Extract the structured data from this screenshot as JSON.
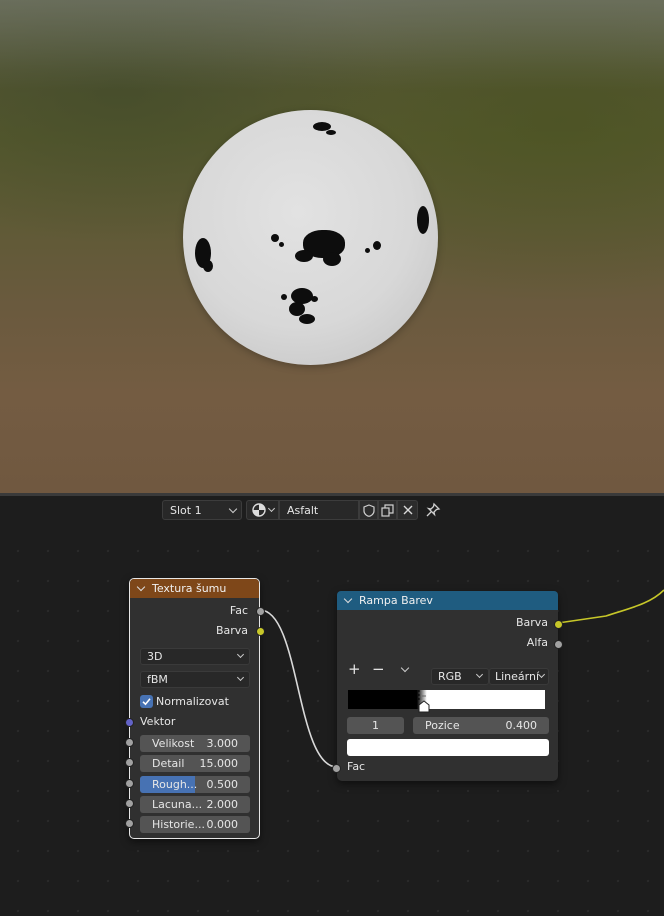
{
  "header": {
    "slot": "Slot 1",
    "material_name": "Asfalt"
  },
  "noise_node": {
    "title": "Textura šumu",
    "outputs": [
      "Fac",
      "Barva"
    ],
    "dimension": "3D",
    "type": "fBM",
    "normalize_label": "Normalizovat",
    "normalize_checked": true,
    "vector_label": "Vektor",
    "fields": [
      {
        "label": "Velikost",
        "value": "3.000"
      },
      {
        "label": "Detail",
        "value": "15.000"
      },
      {
        "label": "Rough...",
        "value": "0.500",
        "fraction": 0.5
      },
      {
        "label": "Lacuna...",
        "value": "2.000"
      },
      {
        "label": "Historie...",
        "value": "0.000"
      }
    ]
  },
  "ramp_node": {
    "title": "Rampa Barev",
    "outputs": [
      "Barva",
      "Alfa"
    ],
    "add": "+",
    "remove": "−",
    "color_mode": "RGB",
    "interpolation": "Lineární",
    "stop_index": "1",
    "position_label": "Pozice",
    "position_value": "0.400",
    "input_label": "Fac",
    "stop_color": "#ffffff"
  },
  "colors": {
    "noise_header": "#7e4719",
    "ramp_header": "#1f5c80",
    "socket_gray": "#a1a1a1",
    "socket_yellow": "#c7c729",
    "socket_vector": "#6363c7",
    "link_yellow": "#c7c729"
  }
}
